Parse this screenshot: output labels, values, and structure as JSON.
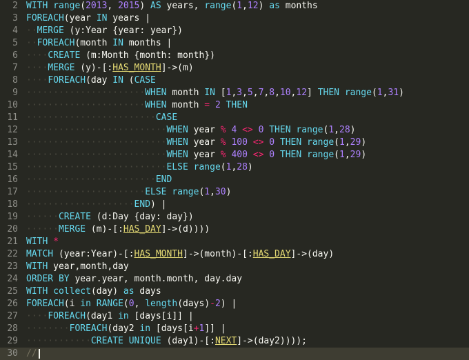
{
  "editor": {
    "lines": [
      {
        "n": "2",
        "t": [
          {
            "c": "kw",
            "v": "WITH"
          },
          {
            "v": " "
          },
          {
            "c": "fn",
            "v": "range"
          },
          {
            "v": "("
          },
          {
            "c": "num",
            "v": "2013"
          },
          {
            "v": ", "
          },
          {
            "c": "num",
            "v": "2015"
          },
          {
            "v": ") "
          },
          {
            "c": "kw",
            "v": "AS"
          },
          {
            "v": " years, "
          },
          {
            "c": "fn",
            "v": "range"
          },
          {
            "v": "("
          },
          {
            "c": "num",
            "v": "1"
          },
          {
            "v": ","
          },
          {
            "c": "num",
            "v": "12"
          },
          {
            "v": ") "
          },
          {
            "c": "kw",
            "v": "as"
          },
          {
            "v": " months"
          }
        ]
      },
      {
        "n": "3",
        "t": [
          {
            "c": "kw",
            "v": "FOREACH"
          },
          {
            "v": "(year "
          },
          {
            "c": "kw",
            "v": "IN"
          },
          {
            "v": " years |"
          }
        ]
      },
      {
        "n": "4",
        "t": [
          {
            "c": "ws",
            "v": "··"
          },
          {
            "c": "kw",
            "v": "MERGE"
          },
          {
            "v": " (y:Year {year: year})"
          }
        ]
      },
      {
        "n": "5",
        "t": [
          {
            "c": "ws",
            "v": "··"
          },
          {
            "c": "kw",
            "v": "FOREACH"
          },
          {
            "v": "(month "
          },
          {
            "c": "kw",
            "v": "IN"
          },
          {
            "v": " months |"
          }
        ]
      },
      {
        "n": "6",
        "t": [
          {
            "c": "ws",
            "v": "····"
          },
          {
            "c": "kw",
            "v": "CREATE"
          },
          {
            "v": " (m:Month {month: month})"
          }
        ]
      },
      {
        "n": "7",
        "t": [
          {
            "c": "ws",
            "v": "····"
          },
          {
            "c": "kw",
            "v": "MERGE"
          },
          {
            "v": " (y)-[:"
          },
          {
            "c": "lbl",
            "v": "HAS_MONTH"
          },
          {
            "v": "]->(m)"
          }
        ]
      },
      {
        "n": "8",
        "t": [
          {
            "c": "ws",
            "v": "····"
          },
          {
            "c": "kw",
            "v": "FOREACH"
          },
          {
            "v": "(day "
          },
          {
            "c": "kw",
            "v": "IN"
          },
          {
            "v": " ("
          },
          {
            "c": "kw",
            "v": "CASE"
          }
        ]
      },
      {
        "n": "9",
        "t": [
          {
            "c": "ws",
            "v": "······················"
          },
          {
            "c": "kw",
            "v": "WHEN"
          },
          {
            "v": " month "
          },
          {
            "c": "kw",
            "v": "IN"
          },
          {
            "v": " ["
          },
          {
            "c": "num",
            "v": "1"
          },
          {
            "v": ","
          },
          {
            "c": "num",
            "v": "3"
          },
          {
            "v": ","
          },
          {
            "c": "num",
            "v": "5"
          },
          {
            "v": ","
          },
          {
            "c": "num",
            "v": "7"
          },
          {
            "v": ","
          },
          {
            "c": "num",
            "v": "8"
          },
          {
            "v": ","
          },
          {
            "c": "num",
            "v": "10"
          },
          {
            "v": ","
          },
          {
            "c": "num",
            "v": "12"
          },
          {
            "v": "] "
          },
          {
            "c": "kw",
            "v": "THEN"
          },
          {
            "v": " "
          },
          {
            "c": "fn",
            "v": "range"
          },
          {
            "v": "("
          },
          {
            "c": "num",
            "v": "1"
          },
          {
            "v": ","
          },
          {
            "c": "num",
            "v": "31"
          },
          {
            "v": ")"
          }
        ]
      },
      {
        "n": "10",
        "t": [
          {
            "c": "ws",
            "v": "······················"
          },
          {
            "c": "kw",
            "v": "WHEN"
          },
          {
            "v": " month "
          },
          {
            "c": "op",
            "v": "="
          },
          {
            "v": " "
          },
          {
            "c": "num",
            "v": "2"
          },
          {
            "v": " "
          },
          {
            "c": "kw",
            "v": "THEN"
          }
        ]
      },
      {
        "n": "11",
        "t": [
          {
            "c": "ws",
            "v": "························"
          },
          {
            "c": "kw",
            "v": "CASE"
          }
        ]
      },
      {
        "n": "12",
        "t": [
          {
            "c": "ws",
            "v": "··························"
          },
          {
            "c": "kw",
            "v": "WHEN"
          },
          {
            "v": " year "
          },
          {
            "c": "op",
            "v": "%"
          },
          {
            "v": " "
          },
          {
            "c": "num",
            "v": "4"
          },
          {
            "v": " "
          },
          {
            "c": "op",
            "v": "<>"
          },
          {
            "v": " "
          },
          {
            "c": "num",
            "v": "0"
          },
          {
            "v": " "
          },
          {
            "c": "kw",
            "v": "THEN"
          },
          {
            "v": " "
          },
          {
            "c": "fn",
            "v": "range"
          },
          {
            "v": "("
          },
          {
            "c": "num",
            "v": "1"
          },
          {
            "v": ","
          },
          {
            "c": "num",
            "v": "28"
          },
          {
            "v": ")"
          }
        ]
      },
      {
        "n": "13",
        "t": [
          {
            "c": "ws",
            "v": "··························"
          },
          {
            "c": "kw",
            "v": "WHEN"
          },
          {
            "v": " year "
          },
          {
            "c": "op",
            "v": "%"
          },
          {
            "v": " "
          },
          {
            "c": "num",
            "v": "100"
          },
          {
            "v": " "
          },
          {
            "c": "op",
            "v": "<>"
          },
          {
            "v": " "
          },
          {
            "c": "num",
            "v": "0"
          },
          {
            "v": " "
          },
          {
            "c": "kw",
            "v": "THEN"
          },
          {
            "v": " "
          },
          {
            "c": "fn",
            "v": "range"
          },
          {
            "v": "("
          },
          {
            "c": "num",
            "v": "1"
          },
          {
            "v": ","
          },
          {
            "c": "num",
            "v": "29"
          },
          {
            "v": ")"
          }
        ]
      },
      {
        "n": "14",
        "t": [
          {
            "c": "ws",
            "v": "··························"
          },
          {
            "c": "kw",
            "v": "WHEN"
          },
          {
            "v": " year "
          },
          {
            "c": "op",
            "v": "%"
          },
          {
            "v": " "
          },
          {
            "c": "num",
            "v": "400"
          },
          {
            "v": " "
          },
          {
            "c": "op",
            "v": "<>"
          },
          {
            "v": " "
          },
          {
            "c": "num",
            "v": "0"
          },
          {
            "v": " "
          },
          {
            "c": "kw",
            "v": "THEN"
          },
          {
            "v": " "
          },
          {
            "c": "fn",
            "v": "range"
          },
          {
            "v": "("
          },
          {
            "c": "num",
            "v": "1"
          },
          {
            "v": ","
          },
          {
            "c": "num",
            "v": "29"
          },
          {
            "v": ")"
          }
        ]
      },
      {
        "n": "15",
        "t": [
          {
            "c": "ws",
            "v": "··························"
          },
          {
            "c": "kw",
            "v": "ELSE"
          },
          {
            "v": " "
          },
          {
            "c": "fn",
            "v": "range"
          },
          {
            "v": "("
          },
          {
            "c": "num",
            "v": "1"
          },
          {
            "v": ","
          },
          {
            "c": "num",
            "v": "28"
          },
          {
            "v": ")"
          }
        ]
      },
      {
        "n": "16",
        "t": [
          {
            "c": "ws",
            "v": "························"
          },
          {
            "c": "kw",
            "v": "END"
          }
        ]
      },
      {
        "n": "17",
        "t": [
          {
            "c": "ws",
            "v": "······················"
          },
          {
            "c": "kw",
            "v": "ELSE"
          },
          {
            "v": " "
          },
          {
            "c": "fn",
            "v": "range"
          },
          {
            "v": "("
          },
          {
            "c": "num",
            "v": "1"
          },
          {
            "v": ","
          },
          {
            "c": "num",
            "v": "30"
          },
          {
            "v": ")"
          }
        ]
      },
      {
        "n": "18",
        "t": [
          {
            "c": "ws",
            "v": "····················"
          },
          {
            "c": "kw",
            "v": "END"
          },
          {
            "v": ") |"
          }
        ]
      },
      {
        "n": "19",
        "t": [
          {
            "c": "ws",
            "v": "······"
          },
          {
            "c": "kw",
            "v": "CREATE"
          },
          {
            "v": " (d:Day {day: day})"
          }
        ]
      },
      {
        "n": "20",
        "t": [
          {
            "c": "ws",
            "v": "······"
          },
          {
            "c": "kw",
            "v": "MERGE"
          },
          {
            "v": " (m)-[:"
          },
          {
            "c": "lbl",
            "v": "HAS_DAY"
          },
          {
            "v": "]->(d))))"
          }
        ]
      },
      {
        "n": "21",
        "t": [
          {
            "c": "kw",
            "v": "WITH"
          },
          {
            "v": " "
          },
          {
            "c": "op",
            "v": "*"
          }
        ]
      },
      {
        "n": "22",
        "t": [
          {
            "c": "kw",
            "v": "MATCH"
          },
          {
            "v": " (year:Year)-[:"
          },
          {
            "c": "lbl",
            "v": "HAS_MONTH"
          },
          {
            "v": "]->(month)-[:"
          },
          {
            "c": "lbl",
            "v": "HAS_DAY"
          },
          {
            "v": "]->(day)"
          }
        ]
      },
      {
        "n": "23",
        "t": [
          {
            "c": "kw",
            "v": "WITH"
          },
          {
            "v": " year,month,day"
          }
        ]
      },
      {
        "n": "24",
        "t": [
          {
            "c": "kw",
            "v": "ORDER BY"
          },
          {
            "v": " year.year, month.month, day.day"
          }
        ]
      },
      {
        "n": "25",
        "t": [
          {
            "c": "kw",
            "v": "WITH"
          },
          {
            "v": " "
          },
          {
            "c": "fn",
            "v": "collect"
          },
          {
            "v": "(day) "
          },
          {
            "c": "kw",
            "v": "as"
          },
          {
            "v": " days"
          }
        ]
      },
      {
        "n": "26",
        "t": [
          {
            "c": "kw",
            "v": "FOREACH"
          },
          {
            "v": "(i "
          },
          {
            "c": "kw",
            "v": "in"
          },
          {
            "v": " "
          },
          {
            "c": "fn",
            "v": "RANGE"
          },
          {
            "v": "("
          },
          {
            "c": "num",
            "v": "0"
          },
          {
            "v": ", "
          },
          {
            "c": "fn",
            "v": "length"
          },
          {
            "v": "(days)"
          },
          {
            "c": "op",
            "v": "-"
          },
          {
            "c": "num",
            "v": "2"
          },
          {
            "v": ") |"
          }
        ]
      },
      {
        "n": "27",
        "t": [
          {
            "c": "ws",
            "v": "····"
          },
          {
            "c": "kw",
            "v": "FOREACH"
          },
          {
            "v": "(day1 "
          },
          {
            "c": "kw",
            "v": "in"
          },
          {
            "v": " [days[i]] |"
          }
        ]
      },
      {
        "n": "28",
        "t": [
          {
            "c": "ws",
            "v": "········"
          },
          {
            "c": "kw",
            "v": "FOREACH"
          },
          {
            "v": "(day2 "
          },
          {
            "c": "kw",
            "v": "in"
          },
          {
            "v": " [days[i"
          },
          {
            "c": "op",
            "v": "+"
          },
          {
            "c": "num",
            "v": "1"
          },
          {
            "v": "]] |"
          }
        ]
      },
      {
        "n": "29",
        "t": [
          {
            "c": "ws",
            "v": "············"
          },
          {
            "c": "kw",
            "v": "CREATE UNIQUE"
          },
          {
            "v": " (day1)-[:"
          },
          {
            "c": "lbl",
            "v": "NEXT"
          },
          {
            "v": "]->(day2))));"
          }
        ]
      },
      {
        "n": "30",
        "t": [
          {
            "c": "cmt",
            "v": "//"
          }
        ]
      }
    ]
  }
}
